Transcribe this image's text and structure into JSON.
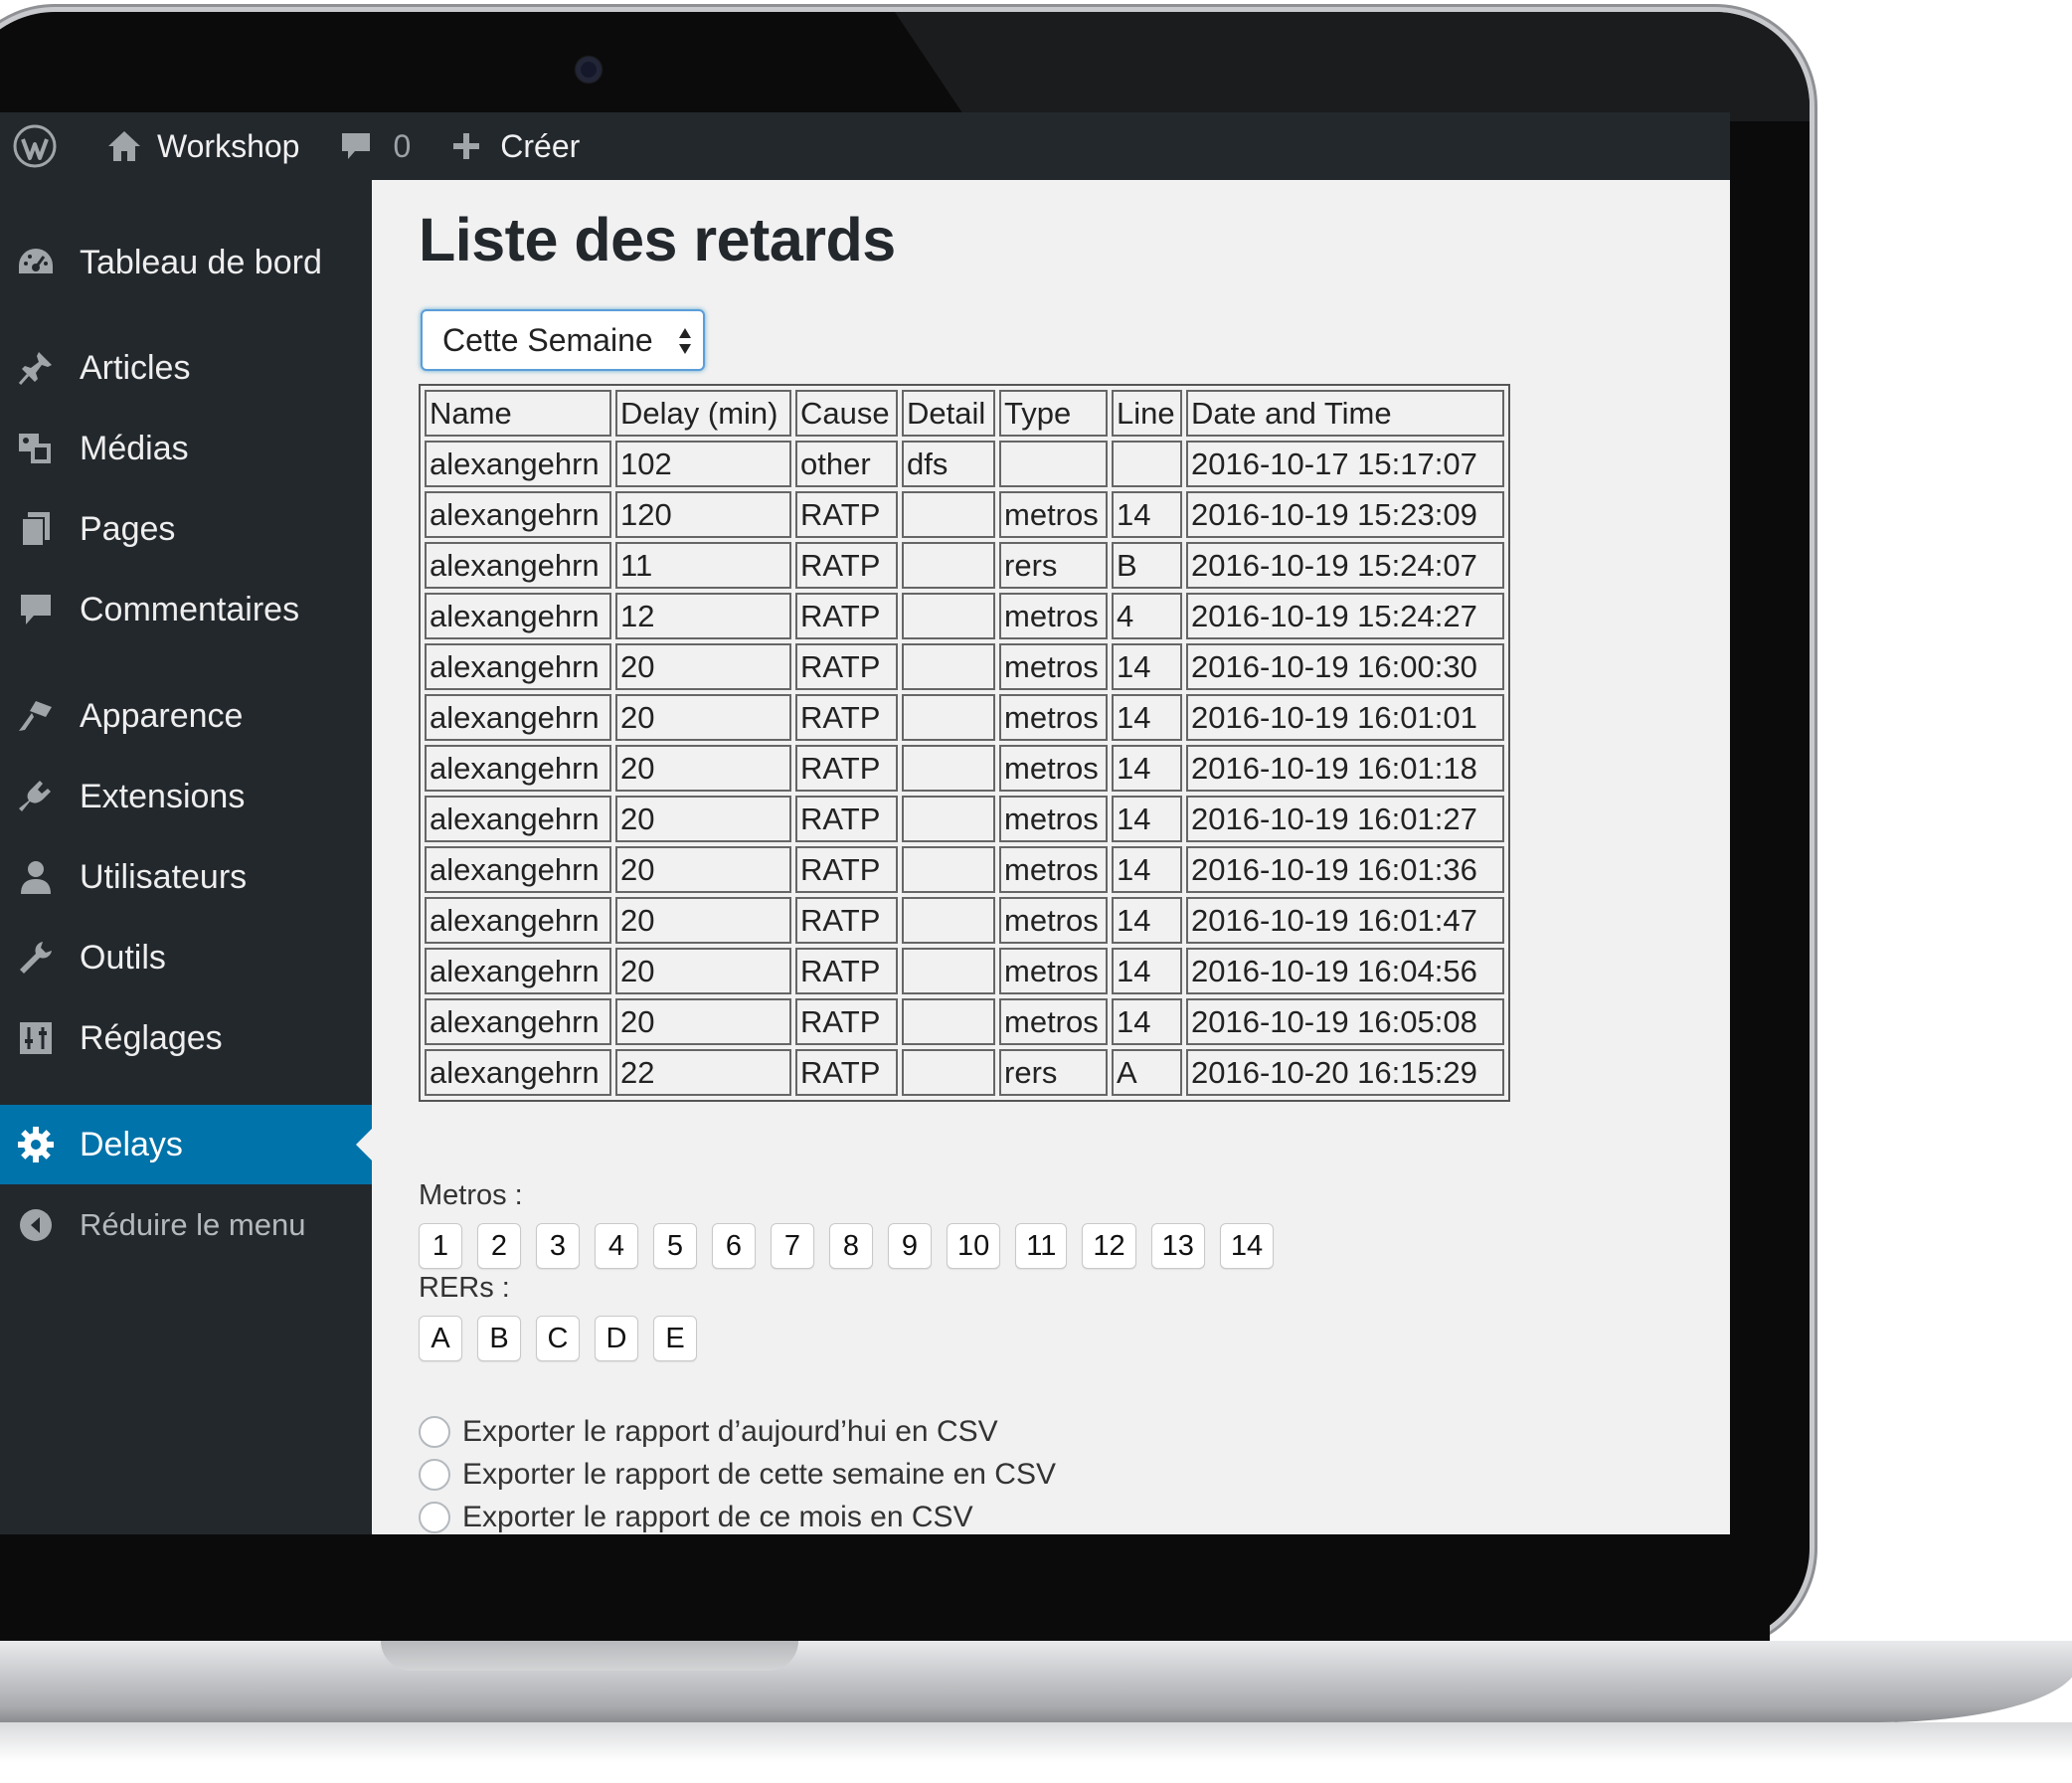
{
  "admin_bar": {
    "site_name": "Workshop",
    "comment_count": "0",
    "new_label": "Créer"
  },
  "sidebar": {
    "items": [
      {
        "label": "Tableau de bord",
        "icon": "dashboard-icon"
      },
      {
        "label": "Articles",
        "icon": "pin-icon"
      },
      {
        "label": "Médias",
        "icon": "media-icon"
      },
      {
        "label": "Pages",
        "icon": "pages-icon"
      },
      {
        "label": "Commentaires",
        "icon": "comment-icon"
      },
      {
        "label": "Apparence",
        "icon": "brush-icon"
      },
      {
        "label": "Extensions",
        "icon": "plugin-icon"
      },
      {
        "label": "Utilisateurs",
        "icon": "user-icon"
      },
      {
        "label": "Outils",
        "icon": "wrench-icon"
      },
      {
        "label": "Réglages",
        "icon": "settings-sliders-icon"
      },
      {
        "label": "Delays",
        "icon": "gear-icon",
        "active": true
      }
    ],
    "collapse_label": "Réduire le menu"
  },
  "page": {
    "title": "Liste des retards",
    "period_select": "Cette Semaine"
  },
  "table": {
    "headers": [
      "Name",
      "Delay (min)",
      "Cause",
      "Detail",
      "Type",
      "Line",
      "Date and Time"
    ],
    "rows": [
      [
        "alexangehrn",
        "102",
        "other",
        "dfs",
        "",
        "",
        "2016-10-17 15:17:07"
      ],
      [
        "alexangehrn",
        "120",
        "RATP",
        "",
        "metros",
        "14",
        "2016-10-19 15:23:09"
      ],
      [
        "alexangehrn",
        "11",
        "RATP",
        "",
        "rers",
        "B",
        "2016-10-19 15:24:07"
      ],
      [
        "alexangehrn",
        "12",
        "RATP",
        "",
        "metros",
        "4",
        "2016-10-19 15:24:27"
      ],
      [
        "alexangehrn",
        "20",
        "RATP",
        "",
        "metros",
        "14",
        "2016-10-19 16:00:30"
      ],
      [
        "alexangehrn",
        "20",
        "RATP",
        "",
        "metros",
        "14",
        "2016-10-19 16:01:01"
      ],
      [
        "alexangehrn",
        "20",
        "RATP",
        "",
        "metros",
        "14",
        "2016-10-19 16:01:18"
      ],
      [
        "alexangehrn",
        "20",
        "RATP",
        "",
        "metros",
        "14",
        "2016-10-19 16:01:27"
      ],
      [
        "alexangehrn",
        "20",
        "RATP",
        "",
        "metros",
        "14",
        "2016-10-19 16:01:36"
      ],
      [
        "alexangehrn",
        "20",
        "RATP",
        "",
        "metros",
        "14",
        "2016-10-19 16:01:47"
      ],
      [
        "alexangehrn",
        "20",
        "RATP",
        "",
        "metros",
        "14",
        "2016-10-19 16:04:56"
      ],
      [
        "alexangehrn",
        "20",
        "RATP",
        "",
        "metros",
        "14",
        "2016-10-19 16:05:08"
      ],
      [
        "alexangehrn",
        "22",
        "RATP",
        "",
        "rers",
        "A",
        "2016-10-20 16:15:29"
      ]
    ]
  },
  "metros": {
    "label": "Metros :",
    "buttons": [
      "1",
      "2",
      "3",
      "4",
      "5",
      "6",
      "7",
      "8",
      "9",
      "10",
      "11",
      "12",
      "13",
      "14"
    ]
  },
  "rers": {
    "label": "RERs :",
    "buttons": [
      "A",
      "B",
      "C",
      "D",
      "E"
    ]
  },
  "exports": [
    "Exporter le rapport d’aujourd’hui en CSV",
    "Exporter le rapport de cette semaine en CSV",
    "Exporter le rapport de ce mois en CSV"
  ],
  "colors": {
    "admin_bar": "#23282d",
    "sidebar": "#23282d",
    "active_menu": "#0073aa",
    "content_bg": "#f1f1f1"
  }
}
